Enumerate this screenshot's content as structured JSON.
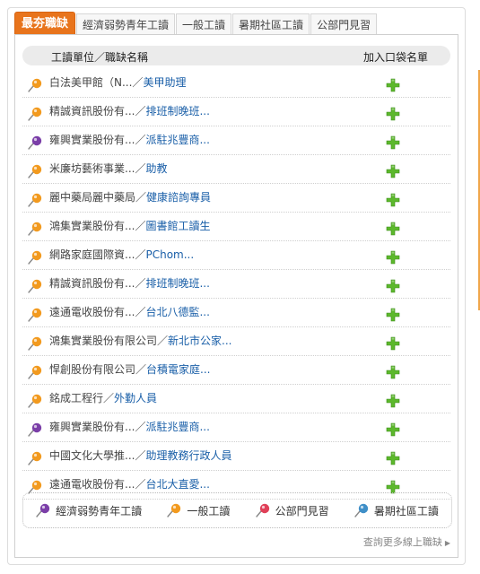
{
  "tabs": [
    {
      "label": "最夯職缺",
      "active": true
    },
    {
      "label": "經濟弱勢青年工讀",
      "active": false
    },
    {
      "label": "一般工讀",
      "active": false
    },
    {
      "label": "暑期社區工讀",
      "active": false
    },
    {
      "label": "公部門見習",
      "active": false
    }
  ],
  "list_header": {
    "name_col": "工讀單位／職缺名稱",
    "add_col": "加入口袋名單"
  },
  "rows": [
    {
      "company": "白法美甲館（N...",
      "sep": "／",
      "job": "美甲助理",
      "pin": "orange"
    },
    {
      "company": "精誠資訊股份有...",
      "sep": "／",
      "job": "排班制晚班...",
      "pin": "orange"
    },
    {
      "company": "雍興實業股份有...",
      "sep": "／",
      "job": "派駐兆豐商...",
      "pin": "purple"
    },
    {
      "company": "米廉坊藝術事業...",
      "sep": "／",
      "job": "助教",
      "pin": "orange"
    },
    {
      "company": "麗中藥局麗中藥局",
      "sep": "／",
      "job": "健康諮詢專員",
      "pin": "orange"
    },
    {
      "company": "鴻集實業股份有...",
      "sep": "／",
      "job": "圖書館工讀生",
      "pin": "orange"
    },
    {
      "company": "網路家庭國際資...",
      "sep": "／",
      "job": "PChom...",
      "pin": "orange"
    },
    {
      "company": "精誠資訊股份有...",
      "sep": "／",
      "job": "排班制晚班...",
      "pin": "orange"
    },
    {
      "company": "遠通電收股份有...",
      "sep": "／",
      "job": "台北八德監...",
      "pin": "orange"
    },
    {
      "company": "鴻集實業股份有限公司",
      "sep": "／",
      "job": "新北市公家...",
      "pin": "orange"
    },
    {
      "company": "悍創股份有限公司",
      "sep": "／",
      "job": "台積電家庭...",
      "pin": "orange"
    },
    {
      "company": "銘成工程行",
      "sep": "／",
      "job": "外勤人員",
      "pin": "orange"
    },
    {
      "company": "雍興實業股份有...",
      "sep": "／",
      "job": "派駐兆豐商...",
      "pin": "purple"
    },
    {
      "company": "中國文化大學推...",
      "sep": "／",
      "job": "助理教務行政人員",
      "pin": "orange"
    },
    {
      "company": "遠通電收股份有...",
      "sep": "／",
      "job": "台北大直愛...",
      "pin": "orange"
    }
  ],
  "legend": [
    {
      "label": "經濟弱勢青年工讀",
      "pin": "purple"
    },
    {
      "label": "一般工讀",
      "pin": "orange"
    },
    {
      "label": "公部門見習",
      "pin": "red"
    },
    {
      "label": "暑期社區工讀",
      "pin": "blue"
    }
  ],
  "more_link": "查詢更多線上職缺",
  "colors": {
    "accent": "#e8741c",
    "link": "#1a5fa8",
    "add_green": "#5cb82c",
    "pin_orange": "#f29a1f",
    "pin_purple": "#7b3fa8",
    "pin_red": "#e04058",
    "pin_blue": "#3f8fc8"
  }
}
